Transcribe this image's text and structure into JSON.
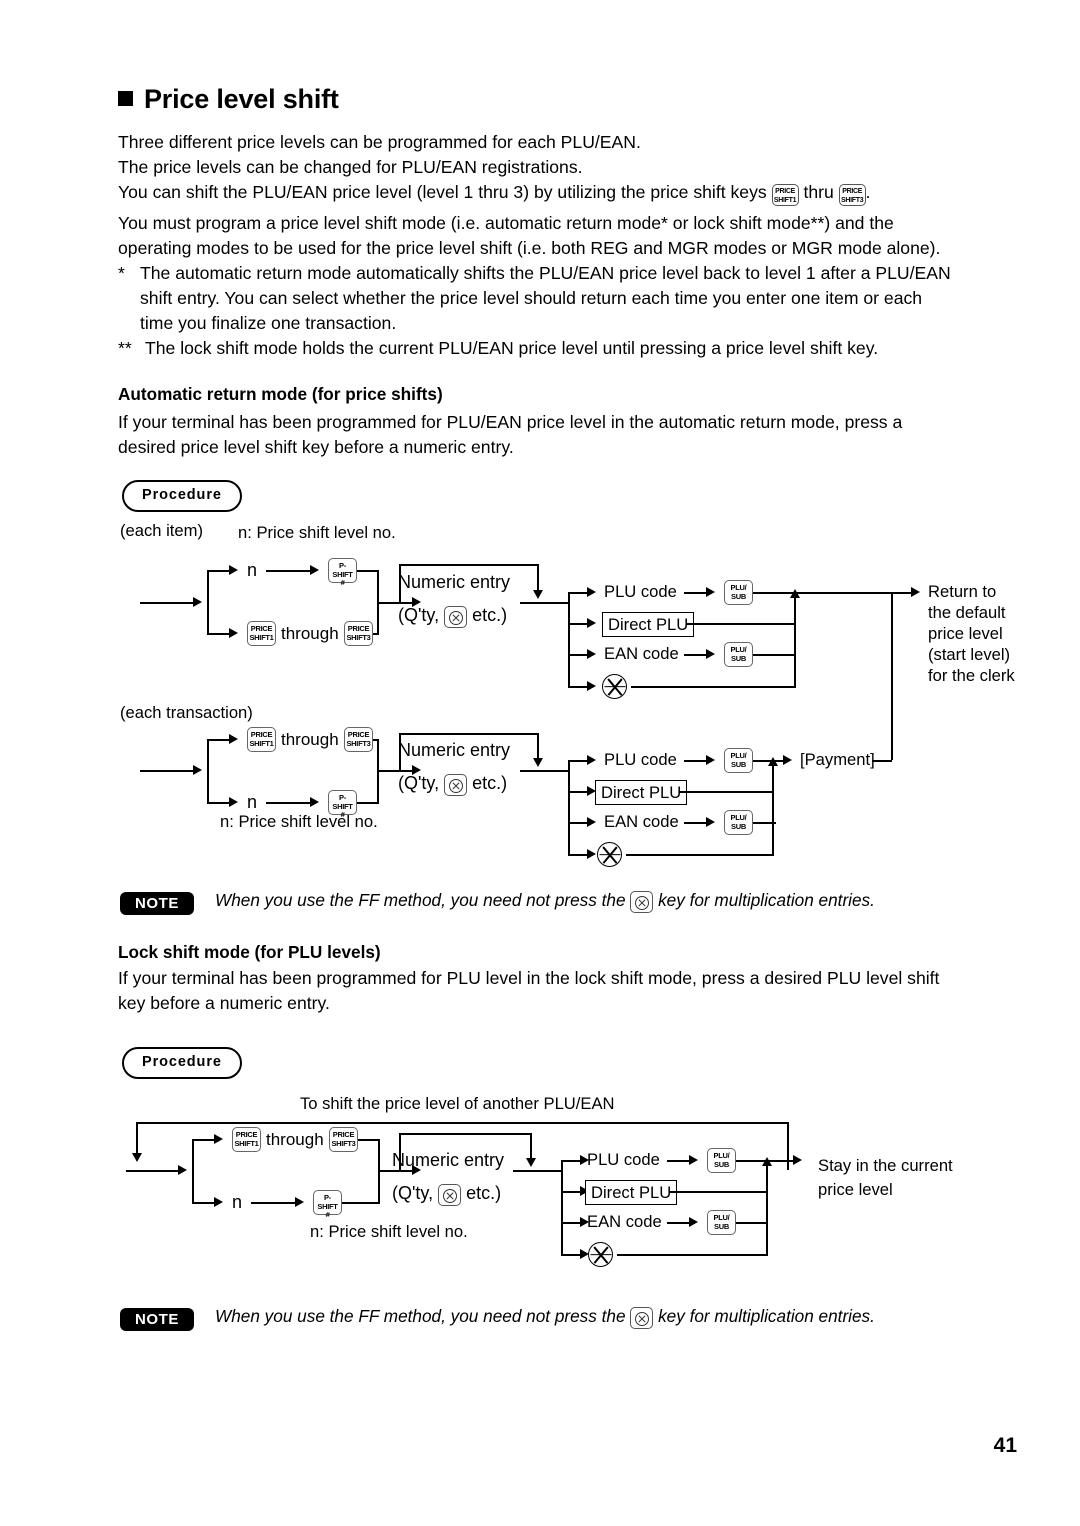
{
  "heading": "Price level shift",
  "intro": [
    "Three different price levels can be programmed for each PLU/EAN.",
    "The price levels can be changed for PLU/EAN registrations."
  ],
  "intro_line3": {
    "before": "You can shift the PLU/EAN price level (level 1 thru 3) by utilizing the price shift keys ",
    "middle": " thru ",
    "after": "."
  },
  "intro4": [
    "You must program a price level shift mode (i.e. automatic return mode* or lock shift mode**) and the",
    "operating modes to be used for the price level shift (i.e. both REG and MGR modes or MGR mode alone)."
  ],
  "footnote1": {
    "marker": "*",
    "lines": [
      "The automatic return mode automatically shifts the PLU/EAN price level back to level 1 after a PLU/EAN",
      "shift entry.  You can select whether the price level should return each time you enter one item or each",
      "time you finalize one transaction."
    ]
  },
  "footnote2": {
    "marker": "**",
    "lines": [
      "The lock shift mode holds the current PLU/EAN price level until pressing a price level shift key."
    ]
  },
  "section_auto": {
    "title": "Automatic return mode (for price shifts)",
    "body": [
      "If your terminal has been programmed for PLU/EAN price level in the automatic return mode, press a",
      "desired price level shift key before a numeric entry."
    ],
    "procedure_label": "Procedure"
  },
  "section_lock": {
    "title": "Lock shift mode (for PLU levels)",
    "body": [
      "If your terminal has been programmed for PLU level in the lock shift mode, press a desired PLU level shift",
      "key before a numeric entry."
    ],
    "procedure_label": "Procedure"
  },
  "keys": {
    "price_shift1": {
      "l1": "PRICE",
      "l2": "SHIFT1"
    },
    "price_shift3": {
      "l1": "PRICE",
      "l2": "SHIFT3"
    },
    "p_shift_hash": {
      "l1": "P-SHIFT",
      "l2": "#"
    },
    "plu_sub": {
      "l1": "PLU/",
      "l2": "SUB"
    },
    "multiply": "multiply-key"
  },
  "diagram_item": {
    "caption": "(each item)",
    "legend": "n: Price shift level no.",
    "n_label": "n",
    "through": "through",
    "numeric_entry": "Numeric entry",
    "qty_before": "(Q'ty, ",
    "qty_after": " etc.)",
    "plu_code": "PLU code",
    "direct_plu": "Direct PLU",
    "ean_code": "EAN code",
    "result": [
      "Return to",
      "the default",
      "price level",
      "(start level)",
      "for the clerk"
    ]
  },
  "diagram_transaction": {
    "caption": "(each transaction)",
    "legend": "n: Price shift level no.",
    "n_label": "n",
    "through": "through",
    "numeric_entry": "Numeric entry",
    "qty_before": "(Q'ty, ",
    "qty_after": " etc.)",
    "plu_code": "PLU code",
    "direct_plu": "Direct PLU",
    "ean_code": "EAN code",
    "payment": "[Payment]"
  },
  "diagram_lock": {
    "top_caption": "To shift the price level of another PLU/EAN",
    "legend": "n: Price shift level no.",
    "n_label": "n",
    "through": "through",
    "numeric_entry": "Numeric entry",
    "qty_before": "(Q'ty, ",
    "qty_after": " etc.)",
    "plu_code": "PLU code",
    "direct_plu": "Direct PLU",
    "ean_code": "EAN code",
    "result": [
      "Stay in the current",
      "price level"
    ]
  },
  "note1": {
    "badge": "NOTE",
    "before": "When you use the FF method,  you need not press the ",
    "after": " key for multiplication entries."
  },
  "note2": {
    "badge": "NOTE",
    "before": "When you use the FF method,  you need not press the ",
    "after": " key for multiplication entries."
  },
  "page_number": "41"
}
